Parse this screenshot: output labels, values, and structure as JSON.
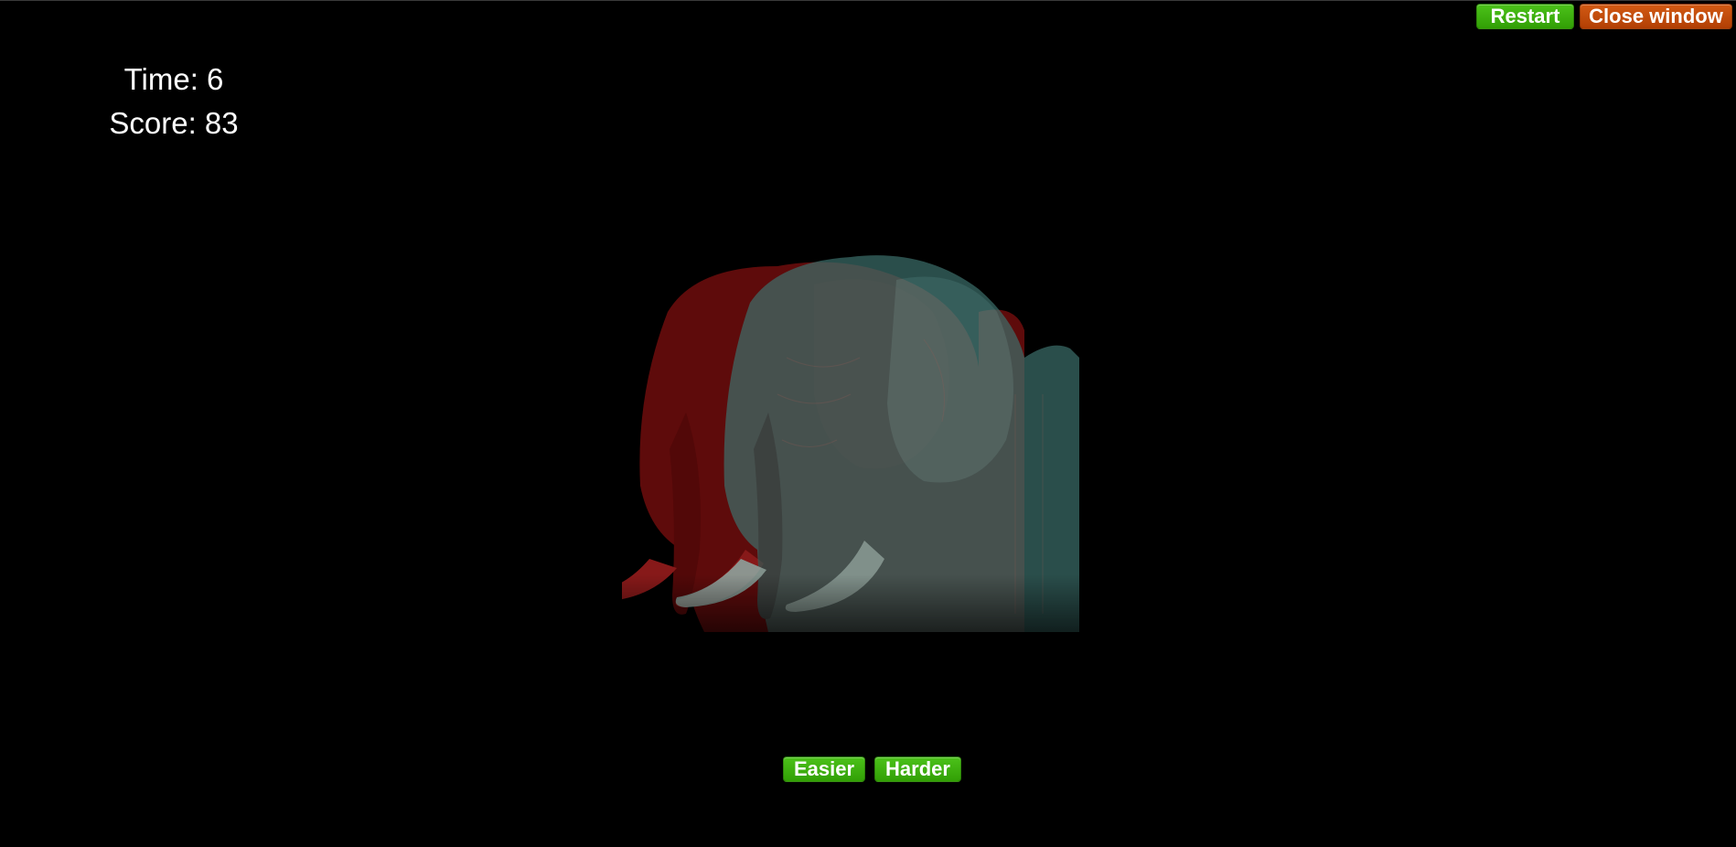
{
  "hud": {
    "time_label": "Time: 6",
    "score_label": "Score: 83"
  },
  "toolbar": {
    "restart_label": "Restart",
    "close_label": "Close window"
  },
  "difficulty": {
    "easier_label": "Easier",
    "harder_label": "Harder"
  },
  "stimulus": {
    "subject": "elephant",
    "style": "red-cyan anaglyph",
    "colors": {
      "red_layer": "#8a1010",
      "cyan_layer": "#3f7f7a",
      "background": "#000000"
    }
  },
  "colors": {
    "button_green": "#3aab0b",
    "button_orange": "#c14a0c"
  }
}
